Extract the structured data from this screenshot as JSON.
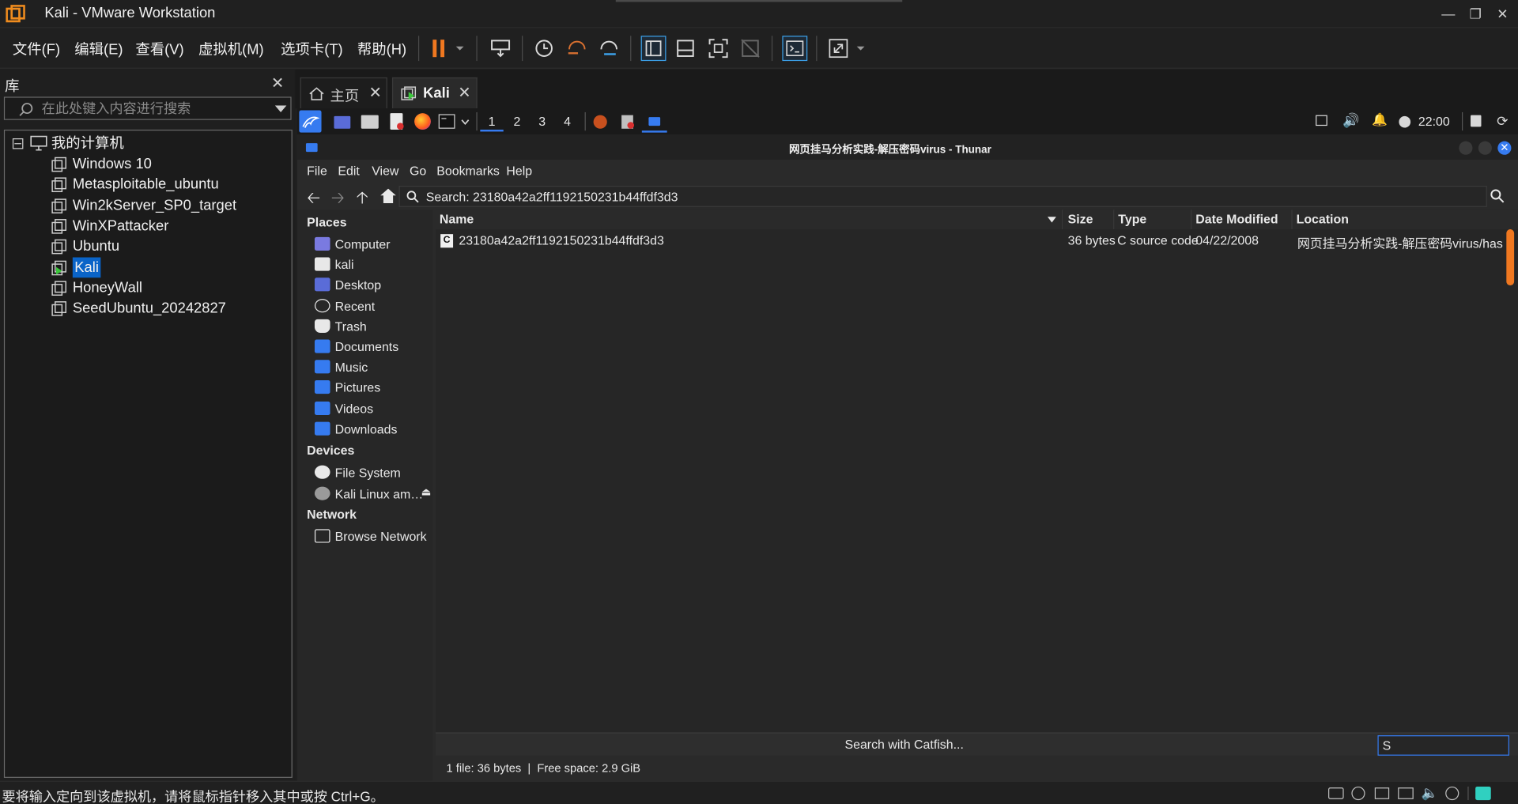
{
  "window": {
    "title": "Kali - VMware Workstation"
  },
  "menu": [
    "文件(F)",
    "编辑(E)",
    "查看(V)",
    "虚拟机(M)",
    "选项卡(T)",
    "帮助(H)"
  ],
  "library": {
    "title": "库",
    "search_placeholder": "在此处键入内容进行搜索",
    "root": "我的计算机",
    "vms": [
      "Windows 10",
      "Metasploitable_ubuntu",
      "Win2kServer_SP0_target",
      "WinXPattacker",
      "Ubuntu",
      "Kali",
      "HoneyWall",
      "SeedUbuntu_20242827"
    ],
    "selected": "Kali"
  },
  "vm_tabs": [
    {
      "label": "主页"
    },
    {
      "label": "Kali"
    }
  ],
  "kali_panel": {
    "workspaces": [
      "1",
      "2",
      "3",
      "4"
    ],
    "clock": "22:00"
  },
  "thunar": {
    "title": "网页挂马分析实践-解压密码virus - Thunar",
    "menu": [
      "File",
      "Edit",
      "View",
      "Go",
      "Bookmarks",
      "Help"
    ],
    "search_text": "Search: 23180a42a2ff1192150231b44ffdf3d3",
    "sidebar": {
      "places_header": "Places",
      "places": [
        "Computer",
        "kali",
        "Desktop",
        "Recent",
        "Trash",
        "Documents",
        "Music",
        "Pictures",
        "Videos",
        "Downloads"
      ],
      "devices_header": "Devices",
      "devices": [
        "File System",
        "Kali Linux am…"
      ],
      "network_header": "Network",
      "network": [
        "Browse Network"
      ]
    },
    "columns": [
      "Name",
      "Size",
      "Type",
      "Date Modified",
      "Location"
    ],
    "rows": [
      {
        "name": "23180a42a2ff1192150231b44ffdf3d3",
        "size": "36 bytes",
        "type": "C source code",
        "date": "04/22/2008",
        "location": "网页挂马分析实践-解压密码virus/hashed"
      }
    ],
    "catfish_button": "Search with Catfish...",
    "catfish_input": "S",
    "status": "1 file: 36 bytes  |  Free space: 2.9 GiB"
  },
  "statusbar": {
    "text": "要将输入定向到该虚拟机，请将鼠标指针移入其中或按 Ctrl+G。"
  },
  "colors": {
    "accent": "#0a64c8",
    "pause": "#f07820",
    "kali_blue": "#367bf0"
  }
}
